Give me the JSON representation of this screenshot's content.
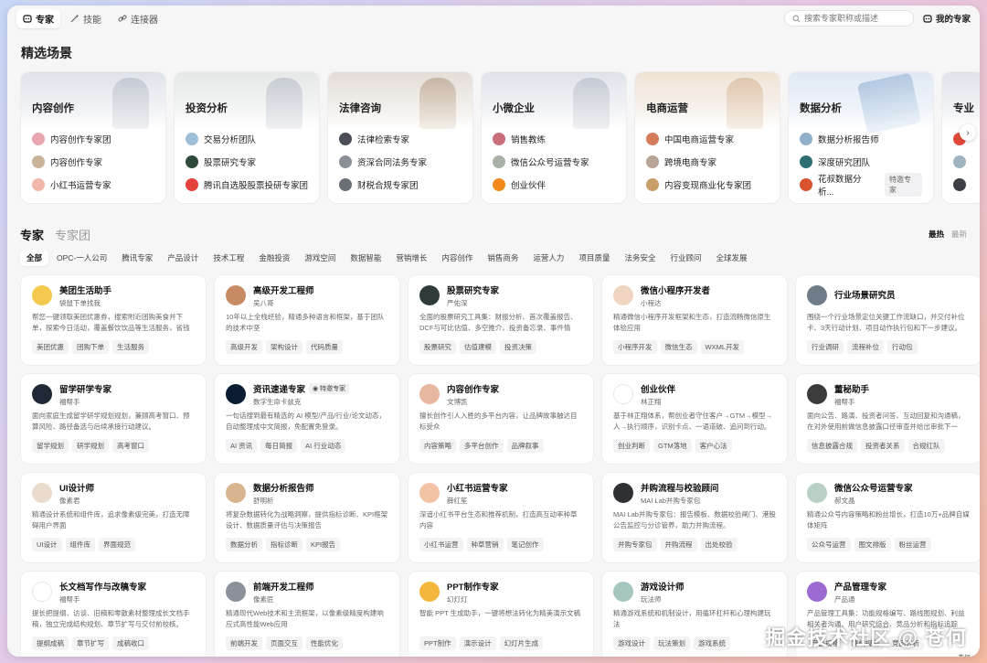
{
  "topbar": {
    "tabs": [
      {
        "label": "专家",
        "icon": "robot-icon",
        "active": true
      },
      {
        "label": "技能",
        "icon": "wand-icon",
        "active": false
      },
      {
        "label": "连接器",
        "icon": "link-icon",
        "active": false
      }
    ],
    "search_placeholder": "搜索专家职称或描述",
    "my_experts": "我的专家"
  },
  "featured": {
    "title": "精选场景",
    "scenes": [
      {
        "title": "内容创作",
        "items": [
          "内容创作专家团",
          "内容创作专家",
          "小红书运营专家"
        ]
      },
      {
        "title": "投资分析",
        "items": [
          "交易分析团队",
          "股票研究专家",
          "腾讯自选股股票投研专家团"
        ]
      },
      {
        "title": "法律咨询",
        "items": [
          "法律检索专家",
          "资深合同法务专家",
          "财税合规专家团"
        ]
      },
      {
        "title": "小微企业",
        "items": [
          "销售教练",
          "微信公众号运营专家",
          "创业伙伴"
        ]
      },
      {
        "title": "电商运营",
        "items": [
          "中国电商运营专家",
          "跨境电商专家",
          "内容变现商业化专家团"
        ]
      },
      {
        "title": "数据分析",
        "items": [
          "数据分析报告师",
          "深度研究团队",
          "花叔数据分析..."
        ],
        "chip": "特邀专家"
      },
      {
        "title": "专业"
      }
    ]
  },
  "list": {
    "tabs": [
      "专家",
      "专家团"
    ],
    "sort": [
      "最热",
      "最新"
    ],
    "categories": [
      "全部",
      "OPC-一人公司",
      "腾讯专家",
      "产品设计",
      "技术工程",
      "金融投资",
      "游戏空间",
      "数据智能",
      "营销增长",
      "内容创作",
      "销售商务",
      "运营人力",
      "项目质量",
      "法务安全",
      "行业顾问",
      "全球发展"
    ],
    "cards": [
      {
        "name": "美团生活助手",
        "sub": "袋鼠下单找我",
        "desc": "帮您一键领取美团优惠券，搜索附近团购美食并下单，探索今日活动，覆盖餐饮饮品等生活服务，省钱省心。",
        "tags": [
          "美团优惠",
          "团购下单",
          "生活服务"
        ]
      },
      {
        "name": "高级开发工程师",
        "sub": "吴八哥",
        "desc": "10年以上全栈经验，精通多种语言和框架，基于团队的技术中坚",
        "tags": [
          "高级开发",
          "架构设计",
          "代码质量"
        ]
      },
      {
        "name": "股票研究专家",
        "sub": "严佑深",
        "desc": "全面的股票研究工具集：财报分析、首次覆盖报告、DCF与可比估值、多空推介、投资备忘录、事件情景...",
        "tags": [
          "股票研究",
          "估值建模",
          "投资决策"
        ]
      },
      {
        "name": "微信小程序开发者",
        "sub": "小程达",
        "desc": "精通微信小程序开发框架和生态，打造流畅微信原生体验应用",
        "tags": [
          "小程序开发",
          "微信生态",
          "WXML开发"
        ]
      },
      {
        "name": "行业场景研究员",
        "sub": "",
        "desc": "围绕一个行业场景定位关键工作流缺口，并交付补位卡、3天行动计划、项目动作执行包和下一步建议。",
        "tags": [
          "行业调研",
          "流程补位",
          "行动包"
        ]
      },
      {
        "name": "留学研学专家",
        "sub": "福帮手",
        "desc": "面向家庭生成留学研学规划规划，兼顾高考窗口、预算风险、路径备选与后续承接行动建议。",
        "tags": [
          "留学规划",
          "研学规划",
          "高考窗口"
        ]
      },
      {
        "name": "资讯速递专家",
        "sub": "数字生命卡兹克",
        "badge": "特邀专家",
        "desc": "一句话搜到最有精选的 AI 模型/产品/行业/论文动态，自动整理成中文简报，免配置免登录。",
        "tags": [
          "AI 资讯",
          "每日简报",
          "AI 行业动态"
        ]
      },
      {
        "name": "内容创作专家",
        "sub": "文博凯",
        "desc": "擅长创作引人入胜的多平台内容，让品牌故事触达目标受众",
        "tags": [
          "内容策略",
          "多平台创作",
          "品牌叙事"
        ]
      },
      {
        "name": "创业伙伴",
        "sub": "林正翔",
        "desc": "基于林正翔体系，帮创业者守住客户→GTM→模型→人→执行顺序，识别卡点、一语道破、追问到行动。",
        "tags": [
          "创业判断",
          "GTM落地",
          "客户心法"
        ]
      },
      {
        "name": "董秘助手",
        "sub": "福帮手",
        "desc": "面向公告、路演、投资者问答、互动回复和沟通稿，在对外使用前做信息披露口径审查并给出审批下一步。",
        "tags": [
          "信息披露合规",
          "投资者关系",
          "合规红队"
        ]
      },
      {
        "name": "UI设计师",
        "sub": "像素君",
        "desc": "精通设计系统和组件库，追求像素级完美，打造无障碍用户界面",
        "tags": [
          "UI设计",
          "组件库",
          "界面规范"
        ]
      },
      {
        "name": "数据分析报告师",
        "sub": "舒明析",
        "desc": "将复杂数据转化为战略洞察，提供指标诊断、KPI框架设计、数据质量评估与决策报告",
        "tags": [
          "数据分析",
          "指标诊断",
          "KPI报告"
        ]
      },
      {
        "name": "小红书运营专家",
        "sub": "薛红笙",
        "desc": "深谙小红书平台生态和推荐机制，打造高互动率种草内容",
        "tags": [
          "小红书运营",
          "种草营销",
          "笔记创作"
        ]
      },
      {
        "name": "并购流程与校验顾问",
        "sub": "MAI Lab并购专家包",
        "desc": "MAI Lab并购专家包：报告模板、数据校验闸门、港股公告监控与分诊管养，助力并购流程。",
        "tags": [
          "并购专家包",
          "并购流程",
          "出处校验"
        ]
      },
      {
        "name": "微信公众号运营专家",
        "sub": "郝文晶",
        "desc": "精通公众号内容策略和粉丝增长，打造10万+品牌自媒体矩阵",
        "tags": [
          "公众号运营",
          "图文排版",
          "粉丝运营"
        ]
      },
      {
        "name": "长文档写作与改稿专家",
        "sub": "福帮手",
        "desc": "提长把提纲、访谈、旧稿和零散素材整理成长文档手稿，独立完成结构规划、章节扩写与交付前校核。",
        "tags": [
          "提纲成稿",
          "章节扩写",
          "成稿收口"
        ]
      },
      {
        "name": "前端开发工程师",
        "sub": "像素匠",
        "desc": "精通现代Web技术和主流框架，以像素级精度构建响应式高性能Web应用",
        "tags": [
          "前端开发",
          "页面交互",
          "性能优化"
        ]
      },
      {
        "name": "PPT制作专家",
        "sub": "幻灯灯",
        "desc": "智能 PPT 生成助手，一键将想法转化为精美演示文稿",
        "tags": [
          "PPT制作",
          "演示设计",
          "幻灯片生成"
        ]
      },
      {
        "name": "游戏设计师",
        "sub": "玩法师",
        "desc": "精通游戏系统和机制设计，用循环杠杆和心理构建玩法",
        "tags": [
          "游戏设计",
          "玩法策划",
          "游戏系统"
        ]
      },
      {
        "name": "产品管理专家",
        "sub": "产品通",
        "desc": "产品管理工具集：功能规格编写、路线图规划、利益相关者沟通、用户研究综合、竞品分析和指标追踪",
        "tags": [
          "产品规格",
          "路线规划",
          "竞品分析"
        ]
      }
    ]
  },
  "watermark": "掘金技术社区 @ 苍何",
  "watermark_small": "苍何",
  "colors": {
    "accent": "#111111"
  }
}
